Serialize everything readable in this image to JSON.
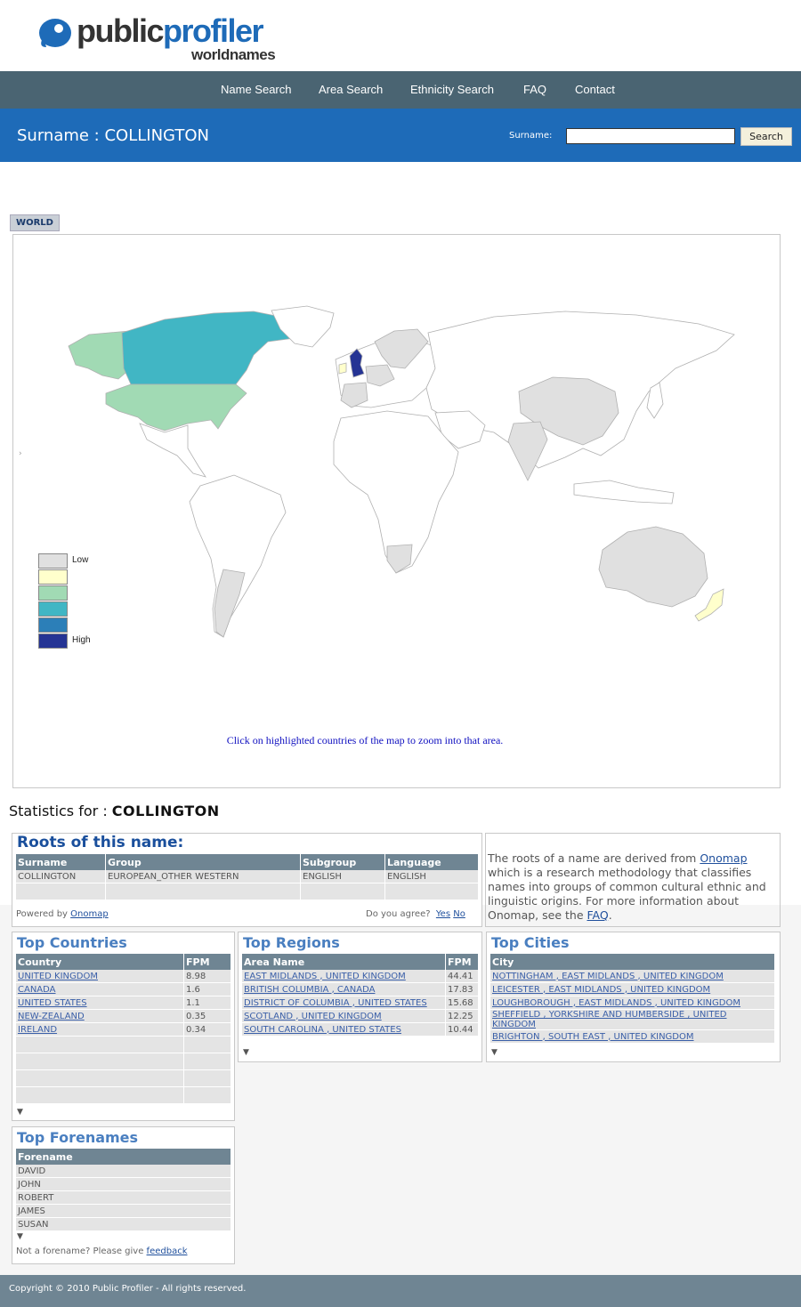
{
  "brand": {
    "logo_part1": "public",
    "logo_part2": "profiler",
    "logo_sub": "worldnames"
  },
  "nav": {
    "items": [
      {
        "label": "Name Search"
      },
      {
        "label": "Area Search"
      },
      {
        "label": "Ethnicity Search"
      },
      {
        "label": "FAQ"
      },
      {
        "label": "Contact"
      }
    ]
  },
  "titlebar": {
    "title": "Surname : COLLINGTON",
    "search_label": "Surname:",
    "search_value": "",
    "search_button": "Search"
  },
  "colors": {
    "nav_bg": "#4a6472",
    "titlebar_bg": "#1e6bb8",
    "legend": [
      "#e0e0e0",
      "#ffffcc",
      "#a1dab4",
      "#41b6c4",
      "#2c7fb8",
      "#253494"
    ]
  },
  "map": {
    "tab": "WORLD",
    "legend_low": "Low",
    "legend_high": "High",
    "caption": "Click on highlighted countries of the map to zoom into that area."
  },
  "stats": {
    "label": "Statistics for : ",
    "name": "COLLINGTON"
  },
  "roots": {
    "title": "Roots of this name:",
    "columns": [
      "Surname",
      "Group",
      "Subgroup",
      "Language"
    ],
    "row": [
      "COLLINGTON",
      "EUROPEAN_OTHER WESTERN",
      "ENGLISH",
      "ENGLISH"
    ],
    "powered_by": "Powered by ",
    "powered_link": "Onomap",
    "agree": "Do you agree?",
    "yes": "Yes",
    "no": "No"
  },
  "info": {
    "text1": "The roots of a name are derived from ",
    "link1": "Onomap",
    "text2": " which is a research methodology that classifies names into groups of common cultural ethnic and linguistic origins. For more information about Onomap, see the ",
    "link2": "FAQ",
    "text3": "."
  },
  "top_countries": {
    "title": "Top Countries",
    "col1": "Country",
    "col2": "FPM",
    "rows": [
      {
        "name": "UNITED KINGDOM",
        "fpm": "8.98"
      },
      {
        "name": "CANADA",
        "fpm": "1.6"
      },
      {
        "name": "UNITED STATES",
        "fpm": "1.1"
      },
      {
        "name": "NEW-ZEALAND",
        "fpm": "0.35"
      },
      {
        "name": "IRELAND",
        "fpm": "0.34"
      }
    ]
  },
  "top_regions": {
    "title": "Top Regions",
    "col1": "Area Name",
    "col2": "FPM",
    "rows": [
      {
        "name": "EAST MIDLANDS , UNITED KINGDOM",
        "fpm": "44.41"
      },
      {
        "name": "BRITISH COLUMBIA , CANADA",
        "fpm": "17.83"
      },
      {
        "name": "DISTRICT OF COLUMBIA , UNITED STATES",
        "fpm": "15.68"
      },
      {
        "name": "SCOTLAND , UNITED KINGDOM",
        "fpm": "12.25"
      },
      {
        "name": "SOUTH CAROLINA , UNITED STATES",
        "fpm": "10.44"
      }
    ]
  },
  "top_cities": {
    "title": "Top Cities",
    "col1": "City",
    "rows": [
      {
        "name": "NOTTINGHAM , EAST MIDLANDS , UNITED KINGDOM"
      },
      {
        "name": "LEICESTER , EAST MIDLANDS , UNITED KINGDOM"
      },
      {
        "name": "LOUGHBOROUGH , EAST MIDLANDS , UNITED KINGDOM"
      },
      {
        "name": "SHEFFIELD , YORKSHIRE AND HUMBERSIDE , UNITED KINGDOM"
      },
      {
        "name": "BRIGHTON , SOUTH EAST , UNITED KINGDOM"
      }
    ]
  },
  "top_forenames": {
    "title": "Top Forenames",
    "col1": "Forename",
    "rows": [
      "DAVID",
      "JOHN",
      "ROBERT",
      "JAMES",
      "SUSAN"
    ],
    "note": "Not a forename? Please give ",
    "note_link": "feedback"
  },
  "footer": {
    "text": "Copyright © 2010 Public Profiler - All rights reserved."
  }
}
